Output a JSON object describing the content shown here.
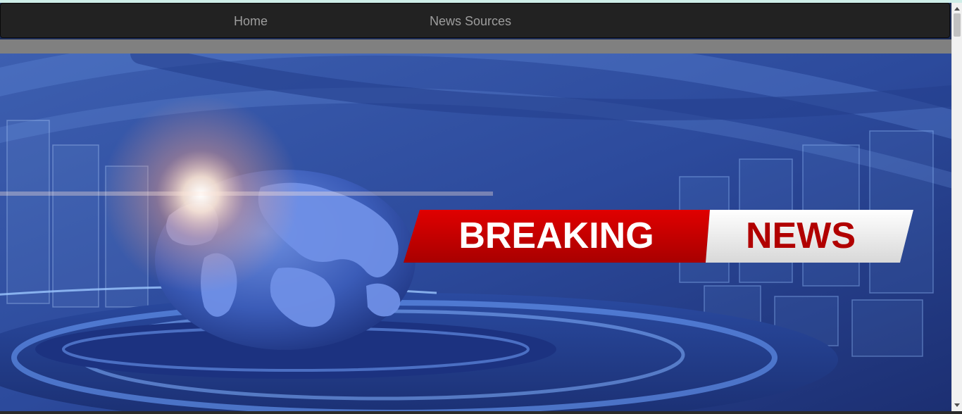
{
  "navbar": {
    "links": [
      {
        "label": "Home"
      },
      {
        "label": "News Sources"
      }
    ]
  },
  "hero": {
    "banner_word_1": "BREAKING",
    "banner_word_2": "NEWS",
    "colors": {
      "banner_red": "#d10000",
      "banner_white": "#f0f0f0",
      "news_text": "#b10000",
      "background_blue": "#2a4a9a"
    }
  }
}
